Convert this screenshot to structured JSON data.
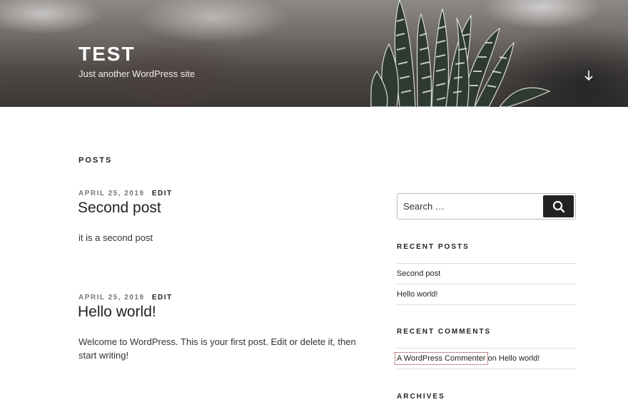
{
  "site": {
    "title": "TEST",
    "description": "Just another WordPress site"
  },
  "main": {
    "heading": "POSTS",
    "posts": [
      {
        "date": "APRIL 25, 2019",
        "edit_label": "EDIT",
        "title": "Second post",
        "content": "it is a second post"
      },
      {
        "date": "APRIL 25, 2019",
        "edit_label": "EDIT",
        "title": "Hello world!",
        "content": "Welcome to WordPress. This is your first post. Edit or delete it, then start writing!"
      }
    ]
  },
  "sidebar": {
    "search": {
      "placeholder": "Search …"
    },
    "recent_posts": {
      "title": "RECENT POSTS",
      "items": [
        "Second post",
        "Hello world!"
      ]
    },
    "recent_comments": {
      "title": "RECENT COMMENTS",
      "items": [
        {
          "author": "A WordPress Commenter",
          "connector": " on ",
          "post": "Hello world!"
        }
      ]
    },
    "archives": {
      "title": "ARCHIVES"
    }
  },
  "icons": {
    "scroll_down": "arrow-down-icon",
    "search": "search-icon"
  },
  "colors": {
    "text": "#222222",
    "meta": "#767676",
    "button": "#222222",
    "focus_outline": "#8b1a1a"
  }
}
